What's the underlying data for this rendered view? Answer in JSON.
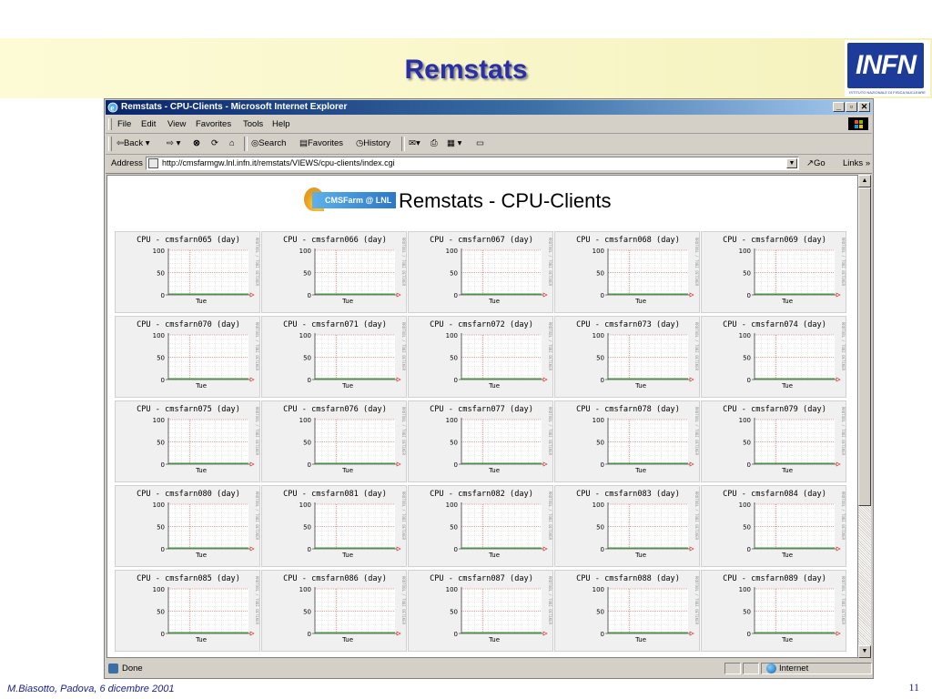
{
  "slide": {
    "title": "Remstats",
    "footer_left": "M.Biasotto, Padova, 6 dicembre 2001",
    "page_number": "11",
    "logo_text": "INFN",
    "logo_subtitle": "ISTITUTO NAZIONALE DI FISICA NUCLEARE",
    "header_bg": "#f8f6c8",
    "title_color": "#2a2fa8"
  },
  "browser": {
    "window_title": "Remstats - CPU-Clients - Microsoft Internet Explorer",
    "menu": [
      "File",
      "Edit",
      "View",
      "Favorites",
      "Tools",
      "Help"
    ],
    "toolbar": {
      "back": "Back",
      "search": "Search",
      "favorites": "Favorites",
      "history": "History"
    },
    "address_label": "Address",
    "address_url": "http://cmsfarmgw.lnl.infn.it/remstats/VIEWS/cpu-clients/index.cgi",
    "go_label": "Go",
    "links_label": "Links »",
    "status_text": "Done",
    "zone_text": "Internet",
    "titlebar_color": "#0a246a"
  },
  "page": {
    "logo_text": "CMSFarm @ LNL",
    "logo_mini": "CMS",
    "heading": "Remstats - CPU-Clients",
    "graph_title_format": "CPU - {host} (day)",
    "y_ticks": [
      "100",
      "50",
      "0"
    ],
    "x_label": "Tue",
    "side_label": "RRDTOOL / TOBI OETIKER",
    "hosts": [
      "cmsfarn065",
      "cmsfarn066",
      "cmsfarn067",
      "cmsfarn068",
      "cmsfarn069",
      "cmsfarn070",
      "cmsfarn071",
      "cmsfarn072",
      "cmsfarn073",
      "cmsfarn074",
      "cmsfarn075",
      "cmsfarn076",
      "cmsfarn077",
      "cmsfarn078",
      "cmsfarn079",
      "cmsfarn080",
      "cmsfarn081",
      "cmsfarn082",
      "cmsfarn083",
      "cmsfarn084",
      "cmsfarn085",
      "cmsfarn086",
      "cmsfarn087",
      "cmsfarn088",
      "cmsfarn089"
    ],
    "line_color": "#2a9a2a",
    "grid_color": "#e05050"
  }
}
